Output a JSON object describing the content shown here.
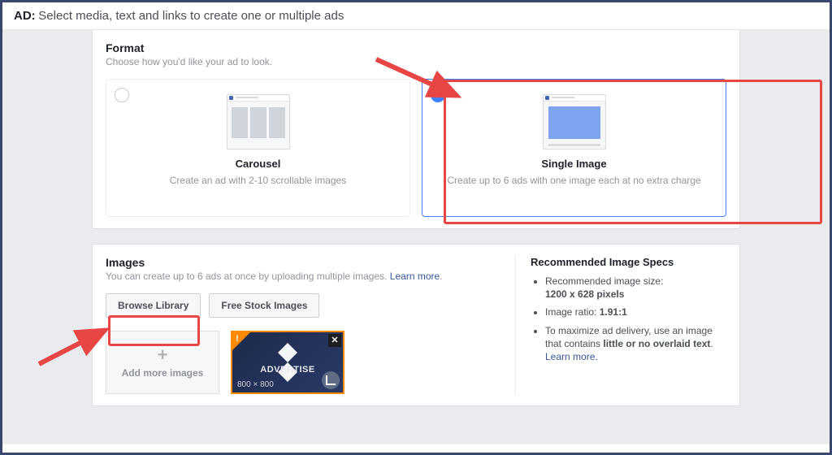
{
  "header": {
    "prefix": "AD:",
    "title": "Select media, text and links to create one or multiple ads"
  },
  "format": {
    "title": "Format",
    "subtitle": "Choose how you'd like your ad to look.",
    "options": [
      {
        "id": "carousel",
        "title": "Carousel",
        "desc": "Create an ad with 2-10 scrollable images",
        "selected": false
      },
      {
        "id": "single-image",
        "title": "Single Image",
        "desc": "Create up to 6 ads with one image each at no extra charge",
        "selected": true
      }
    ]
  },
  "images": {
    "title": "Images",
    "subtitle": "You can create up to 6 ads at once by uploading multiple images.",
    "learn_more": "Learn more",
    "browse_library": "Browse Library",
    "free_stock": "Free Stock Images",
    "add_more": "Add more images",
    "uploaded": {
      "label": "ADVERTISE",
      "dims": "800 × 800"
    }
  },
  "specs": {
    "title": "Recommended Image Specs",
    "size_label": "Recommended image size:",
    "size_value": "1200 x 628 pixels",
    "ratio_label": "Image ratio:",
    "ratio_value": "1.91:1",
    "text_rule_prefix": "To maximize ad delivery, use an image that contains",
    "text_rule_bold": "little or no overlaid text",
    "learn_more": "Learn more."
  }
}
